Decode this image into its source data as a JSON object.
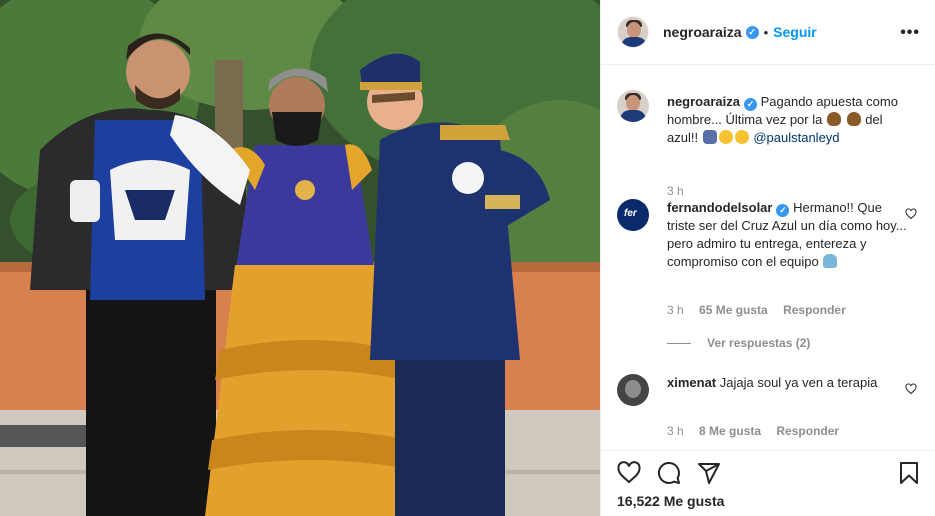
{
  "post": {
    "username": "negroaraiza",
    "separator": "•",
    "follow_label": "Seguir",
    "more_label": "•••",
    "caption": {
      "username": "negroaraiza",
      "text_1": "Pagando apuesta como hombre... Última vez por la",
      "text_2": "del azul!!",
      "mention": "@paulstanleyd",
      "time": "3 h"
    },
    "likes_label": "16,522 Me gusta"
  },
  "comments": [
    {
      "username": "fernandodelsolar",
      "avatar_text": "fer",
      "text": "Hermano!! Que triste ser del Cruz Azul un día como hoy... pero admiro tu entrega, entereza y compromiso con el equipo",
      "time": "3 h",
      "likes": "65 Me gusta",
      "reply": "Responder",
      "view_replies": "Ver respuestas (2)"
    },
    {
      "username": "ximenat",
      "text": "Jajaja soul ya ven a terapia",
      "time": "3 h",
      "likes": "8 Me gusta",
      "reply": "Responder"
    }
  ],
  "icons": [
    "heart-icon",
    "comment-icon",
    "share-icon",
    "bookmark-icon",
    "verified-icon",
    "more-options-icon"
  ],
  "colors": {
    "accent": "#0095f6",
    "verified": "#3897f0",
    "text": "#262626",
    "muted": "#8e8e8e",
    "border": "#efefef"
  }
}
